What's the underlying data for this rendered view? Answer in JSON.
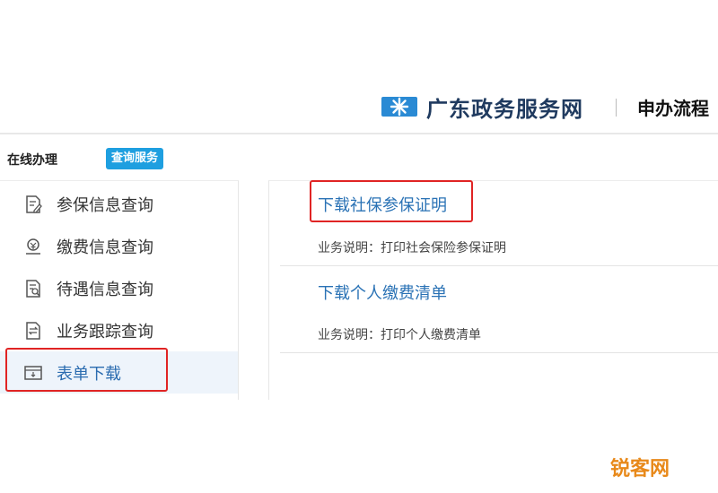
{
  "header": {
    "site_name": "广东政务服务网",
    "nav_process": "申办流程"
  },
  "tabs": {
    "online": "在线办理",
    "query": "查询服务"
  },
  "menu": {
    "items": [
      {
        "label": "参保信息查询",
        "icon": "document-edit-icon"
      },
      {
        "label": "缴费信息查询",
        "icon": "payment-icon"
      },
      {
        "label": "待遇信息查询",
        "icon": "document-search-icon"
      },
      {
        "label": "业务跟踪查询",
        "icon": "document-transfer-icon"
      },
      {
        "label": "表单下载",
        "icon": "form-download-icon",
        "active": true
      }
    ]
  },
  "content": {
    "entries": [
      {
        "link": "下载社保参保证明",
        "desc": "业务说明：打印社会保险参保证明"
      },
      {
        "link": "下载个人缴费清单",
        "desc": "业务说明：打印个人缴费清单"
      }
    ]
  },
  "watermark": "锐客网",
  "colors": {
    "accent": "#1e9fe0",
    "link": "#2a72b5",
    "highlight": "#e02424",
    "brand": "#1f3a5f"
  }
}
